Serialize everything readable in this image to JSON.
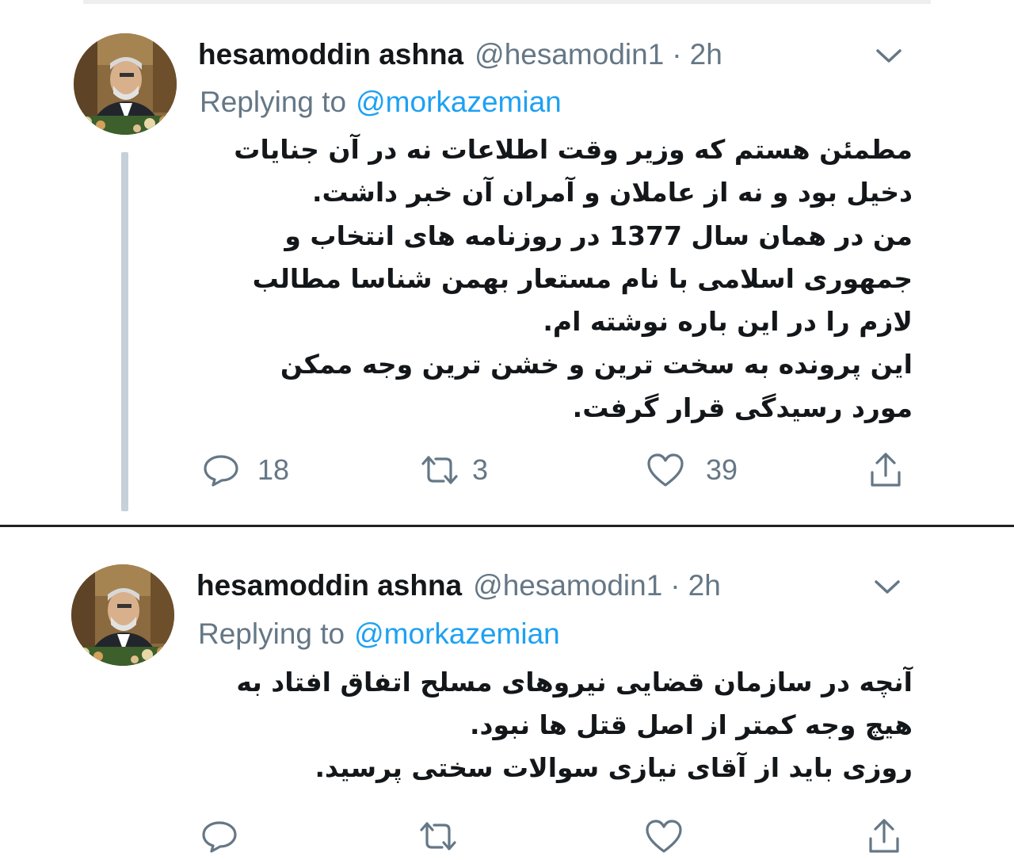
{
  "tweets": [
    {
      "display_name": "hesamoddin ashna",
      "handle": "@hesamodin1",
      "separator": "·",
      "time": "2h",
      "replying_label": "Replying to",
      "replying_to": "@morkazemian",
      "lines": [
        "مطمئن هستم که وزیر وقت اطلاعات نه در آن جنایات",
        "دخیل بود و نه از عاملان و آمران آن خبر داشت.",
        "من در همان سال 1377 در روزنامه های انتخاب و",
        "جمهوری اسلامی با نام مستعار بهمن شناسا مطالب",
        "لازم را در این باره نوشته ام.",
        "این پرونده به سخت ترین و خشن ترین وجه ممکن",
        "مورد رسیدگی قرار گرفت."
      ],
      "replies": "18",
      "retweets": "3",
      "likes": "39"
    },
    {
      "display_name": "hesamoddin ashna",
      "handle": "@hesamodin1",
      "separator": "·",
      "time": "2h",
      "replying_label": "Replying to",
      "replying_to": "@morkazemian",
      "lines": [
        "آنچه در سازمان قضایی نیروهای مسلح اتفاق افتاد به",
        "هیچ وجه کمتر از اصل قتل ها نبود.",
        "روزی باید از آقای نیازی سوالات سختی پرسید."
      ]
    }
  ],
  "colors": {
    "name": "#14171a",
    "secondary": "#657786",
    "link": "#1da1f2",
    "thread_line": "#c5d0d9",
    "separator": "#222222"
  },
  "icons": [
    "avatar",
    "chevron-down-icon",
    "reply-icon",
    "retweet-icon",
    "like-icon",
    "share-icon"
  ]
}
